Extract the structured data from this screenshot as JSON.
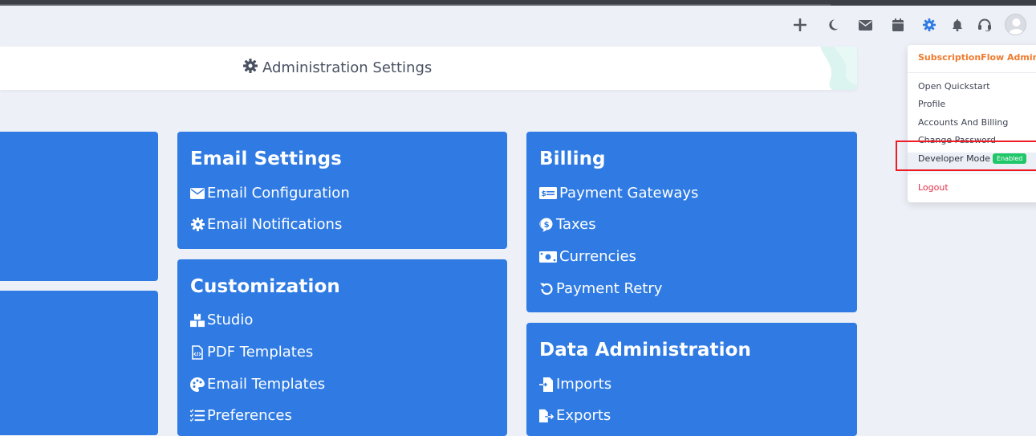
{
  "header": {
    "title": "Administration Settings"
  },
  "topbar": {
    "icons": [
      "plus-icon",
      "moon-icon",
      "envelope-icon",
      "calendar-icon",
      "gear-icon",
      "bell-icon",
      "headset-icon",
      "avatar-icon"
    ]
  },
  "cards": {
    "email": {
      "title": "Email Settings",
      "items": [
        {
          "label": "Email Configuration",
          "icon": "envelope-icon"
        },
        {
          "label": "Email Notifications",
          "icon": "gear-icon"
        }
      ]
    },
    "customization": {
      "title": "Customization",
      "items": [
        {
          "label": "Studio",
          "icon": "boxes-icon"
        },
        {
          "label": "PDF Templates",
          "icon": "file-code-icon"
        },
        {
          "label": "Email Templates",
          "icon": "palette-icon"
        },
        {
          "label": "Preferences",
          "icon": "list-check-icon"
        }
      ]
    },
    "billing": {
      "title": "Billing",
      "items": [
        {
          "label": "Payment Gateways",
          "icon": "money-check-icon"
        },
        {
          "label": "Taxes",
          "icon": "dollar-bubble-icon"
        },
        {
          "label": "Currencies",
          "icon": "money-bill-icon"
        },
        {
          "label": "Payment Retry",
          "icon": "undo-icon"
        }
      ]
    },
    "data_admin": {
      "title": "Data Administration",
      "items": [
        {
          "label": "Imports",
          "icon": "file-import-icon"
        },
        {
          "label": "Exports",
          "icon": "file-export-icon"
        }
      ]
    }
  },
  "dropdown": {
    "heading": "SubscriptionFlow Admin",
    "items": [
      "Open Quickstart",
      "Profile",
      "Accounts And Billing",
      "Change Password"
    ],
    "developer_mode": {
      "label": "Developer Mode",
      "badge": "Enabled"
    },
    "logout": "Logout"
  },
  "colors": {
    "card_blue": "#2f7be3",
    "accent_orange": "#f07a2c",
    "badge_green": "#1fc768",
    "logout_red": "#e0314a",
    "highlight_red": "#ee1c24",
    "active_gear_blue": "#2f7be3"
  }
}
